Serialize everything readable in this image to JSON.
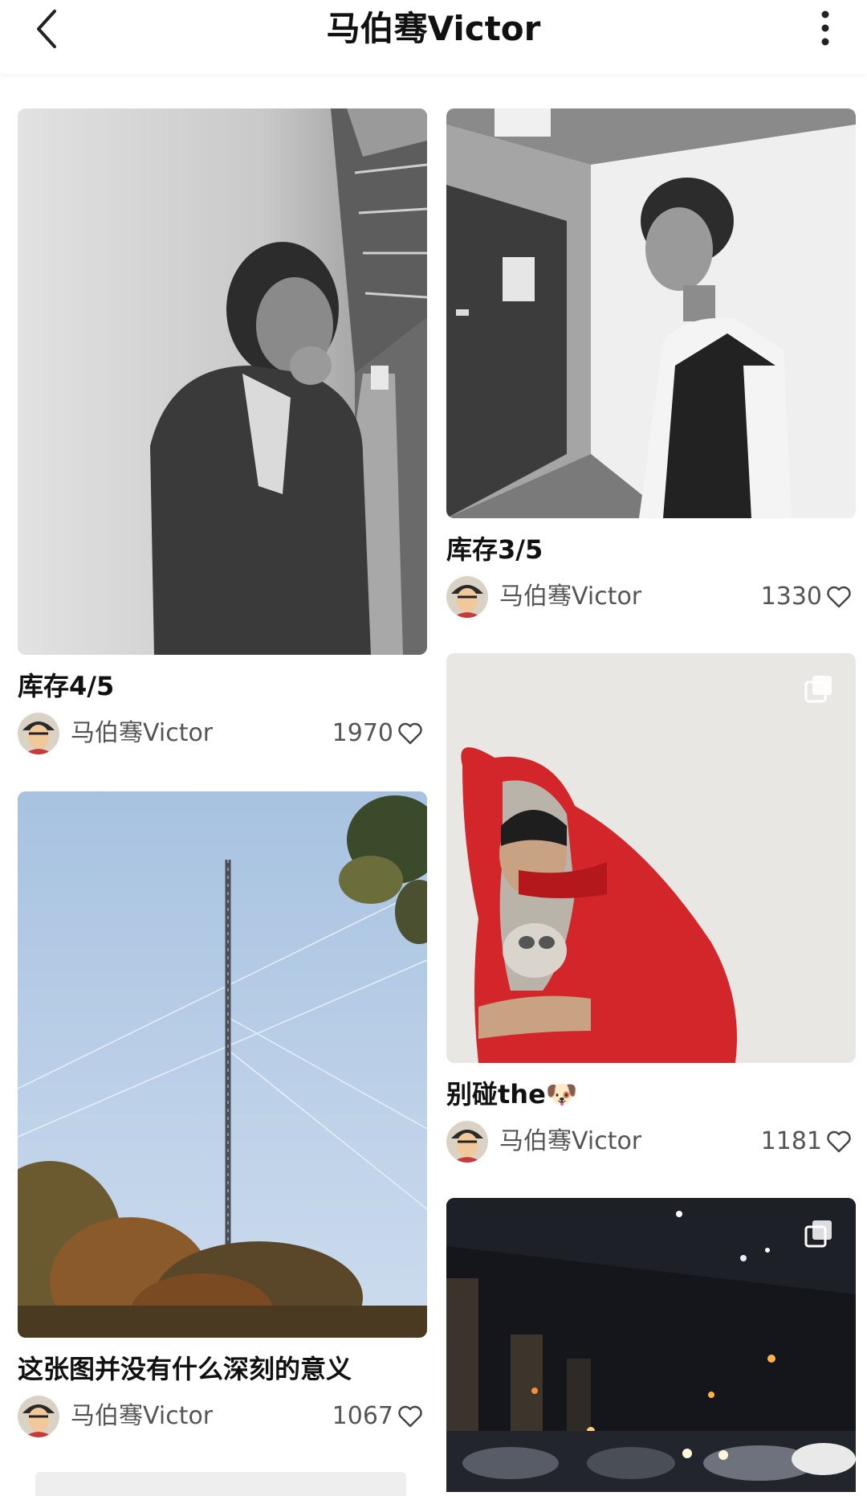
{
  "header": {
    "title": "马伯骞Victor",
    "back_icon": "chevron-left-icon",
    "more_icon": "more-vertical-icon"
  },
  "posts": [
    {
      "title": "库存4/5",
      "author": "马伯骞Victor",
      "likes": "1970",
      "image": "black-and-white photo of man leaning against wall in corridor",
      "multi": false
    },
    {
      "title": "这张图并没有什么深刻的意义",
      "author": "马伯骞Victor",
      "likes": "1067",
      "image": "tall radio tower against blue sky with trees",
      "multi": false
    },
    {
      "title": "库存3/5",
      "author": "马伯骞Victor",
      "likes": "1330",
      "image": "black-and-white photo of man in vest, profile",
      "multi": false
    },
    {
      "title": "别碰the🐶",
      "author": "马伯骞Victor",
      "likes": "1181",
      "image": "person in red puffer jacket holding a puppy",
      "multi": true
    },
    {
      "title": "",
      "author": "",
      "likes": "",
      "image": "night street scene under overpass with car lights",
      "multi": true
    }
  ],
  "colors": {
    "background": "#ffffff",
    "text": "#111111",
    "meta_text": "#555555",
    "red_jacket": "#d8262a",
    "sky": "#bcd3ea"
  }
}
